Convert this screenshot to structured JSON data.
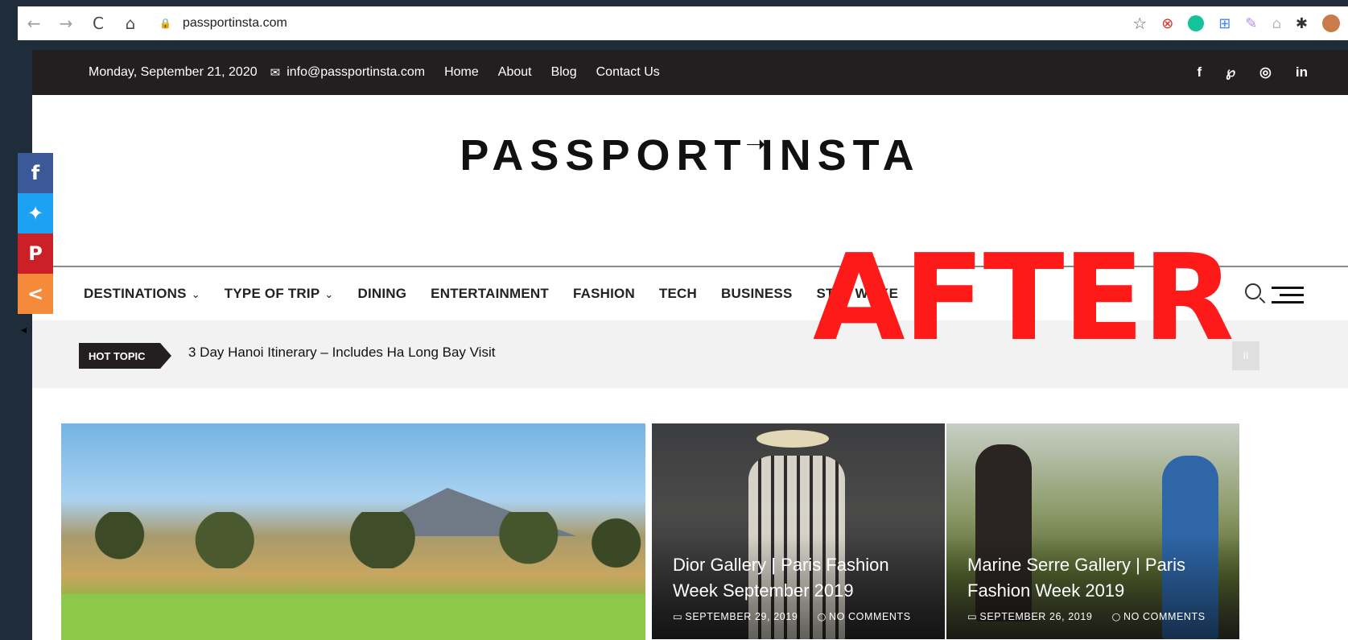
{
  "browser": {
    "back": "←",
    "forward": "→",
    "reload": "C",
    "home": "⌂",
    "url": "passportinsta.com",
    "extensions": [
      {
        "name": "bookmark-star-icon",
        "glyph": "☆"
      },
      {
        "name": "blocker-extension-icon",
        "glyph": "⊗"
      },
      {
        "name": "grammarly-extension-icon",
        "glyph": ""
      },
      {
        "name": "translate-extension-icon",
        "glyph": "⊞"
      },
      {
        "name": "pen-extension-icon",
        "glyph": "✎"
      },
      {
        "name": "ai-extension-icon",
        "glyph": "⌂"
      },
      {
        "name": "puzzle-extensions-icon",
        "glyph": "✱"
      }
    ]
  },
  "topbar": {
    "date": "Monday, September 21, 2020",
    "email": "info@passportinsta.com",
    "links": [
      "Home",
      "About",
      "Blog",
      "Contact Us"
    ],
    "social": [
      "f",
      "℘",
      "◎",
      "in"
    ]
  },
  "logo": {
    "left": "PASSPORT",
    "arrow": "➝",
    "right": "INSTA"
  },
  "mainnav": {
    "items": [
      {
        "label": "DESTINATIONS",
        "dropdown": true
      },
      {
        "label": "TYPE OF TRIP",
        "dropdown": true
      },
      {
        "label": "DINING",
        "dropdown": false
      },
      {
        "label": "ENTERTAINMENT",
        "dropdown": false
      },
      {
        "label": "FASHION",
        "dropdown": false
      },
      {
        "label": "TECH",
        "dropdown": false
      },
      {
        "label": "BUSINESS",
        "dropdown": false
      },
      {
        "label": "STAY WOKE",
        "dropdown": false
      }
    ],
    "chevron": "⌄"
  },
  "ticker": {
    "badge": "HOT TOPIC",
    "text": "3 Day Hanoi Itinerary – Includes Ha Long Bay Visit",
    "pause": "II"
  },
  "overlay": {
    "label": "AFTER",
    "color": "#ff1a1a"
  },
  "cards": [
    {
      "title": "Dior Gallery | Paris Fashion Week September 2019",
      "date": "SEPTEMBER 29, 2019",
      "comments": "NO COMMENTS"
    },
    {
      "title": "Marine Serre Gallery | Paris Fashion Week 2019",
      "date": "SEPTEMBER 26, 2019",
      "comments": "NO COMMENTS"
    }
  ],
  "share": {
    "facebook": "f",
    "twitter": "✦",
    "pinterest": "P",
    "more": "<"
  },
  "colors": {
    "topbar": "#231f20",
    "facebook": "#3b5998",
    "twitter": "#1da1f2",
    "pinterest": "#cb2027",
    "share": "#f58a3a"
  }
}
